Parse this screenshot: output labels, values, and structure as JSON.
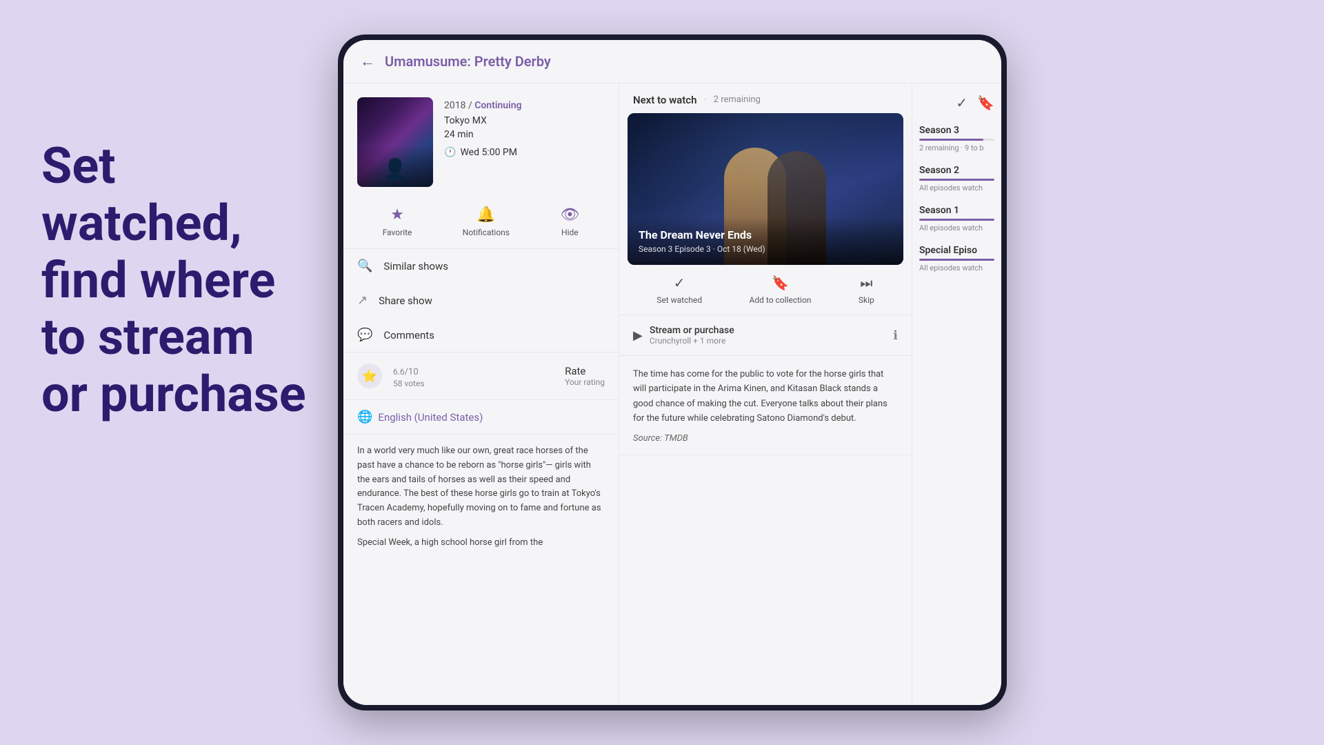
{
  "background_color": "#ddd6f0",
  "left_tagline": {
    "line1": "Set",
    "line2": "watched,",
    "line3": "find where",
    "line4": "to stream",
    "line5": "or purchase"
  },
  "header": {
    "back_label": "←",
    "title": "Umamusume: Pretty Derby"
  },
  "show": {
    "year": "2018",
    "separator": "/",
    "status": "Continuing",
    "network": "Tokyo MX",
    "duration": "24 min",
    "schedule_icon": "🕐",
    "schedule": "Wed 5:00 PM"
  },
  "action_buttons": [
    {
      "id": "favorite",
      "icon": "★",
      "label": "Favorite"
    },
    {
      "id": "notifications",
      "icon": "🔔",
      "label": "Notifications"
    },
    {
      "id": "hide",
      "icon": "👁",
      "label": "Hide"
    }
  ],
  "menu_items": [
    {
      "id": "similar",
      "icon": "🔍",
      "label": "Similar shows"
    },
    {
      "id": "share",
      "icon": "↗",
      "label": "Share show"
    },
    {
      "id": "comments",
      "icon": "💬",
      "label": "Comments"
    }
  ],
  "rating": {
    "value": "6.6",
    "max": "/10",
    "votes": "58 votes",
    "label": "Rate",
    "sublabel": "Your rating"
  },
  "language": {
    "icon": "🌐",
    "label": "English (United States)"
  },
  "description": "In a world very much like our own, great race horses of the past have a chance to be reborn as \"horse girls\"— girls with the ears and tails of horses as well as their speed and endurance. The best of these horse girls go to train at Tokyo's Tracen Academy, hopefully moving on to fame and fortune as both racers and idols.",
  "description2": "Special Week, a high school horse girl from the",
  "next_watch": {
    "title": "Next to watch",
    "separator": "·",
    "remaining": "2 remaining"
  },
  "episode": {
    "title": "The Dream Never Ends",
    "subtitle": "Season 3 Episode 3 · Oct 18 (Wed)"
  },
  "episode_actions": [
    {
      "id": "set-watched",
      "icon": "✓",
      "label": "Set watched"
    },
    {
      "id": "add-collection",
      "icon": "🔖",
      "label": "Add to collection"
    },
    {
      "id": "skip",
      "icon": "⏭",
      "label": "Skip"
    }
  ],
  "stream": {
    "icon": "▶",
    "label": "Stream or purchase",
    "sub": "Crunchyroll + 1 more",
    "info_icon": "ℹ"
  },
  "synopsis": "The time has come for the public to vote for the horse girls that will participate in the Arima Kinen, and Kitasan Black stands a good chance of making the cut. Everyone talks about their plans for the future while celebrating Satono Diamond's debut.",
  "source": "Source: TMDB",
  "seasons": [
    {
      "name": "Season 3",
      "progress": 85,
      "sub": "2 remaining · 9 to b"
    },
    {
      "name": "Season 2",
      "progress": 100,
      "sub": "All episodes watch"
    },
    {
      "name": "Season 1",
      "progress": 100,
      "sub": "All episodes watch"
    },
    {
      "name": "Special Episo",
      "progress": 100,
      "sub": "All episodes watch"
    }
  ],
  "top_icons": [
    {
      "id": "check",
      "icon": "✓"
    },
    {
      "id": "bookmark",
      "icon": "🔖"
    }
  ]
}
